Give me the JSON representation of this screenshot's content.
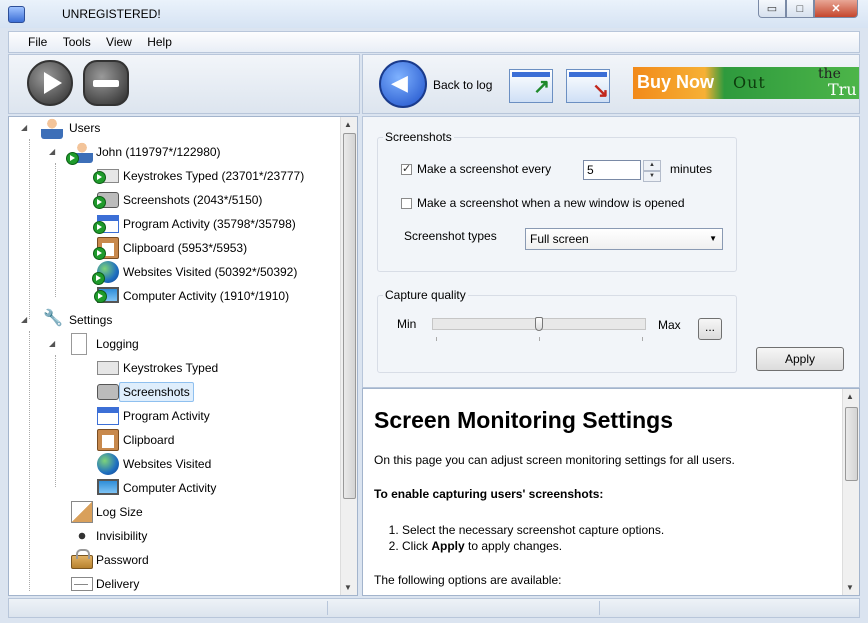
{
  "window": {
    "title": "UNREGISTERED!",
    "controls": {
      "minimize": "▭",
      "maximize": "□",
      "close": "✕"
    }
  },
  "menu": [
    "File",
    "Tools",
    "View",
    "Help"
  ],
  "toolbar": {
    "start_icon": "play-icon",
    "stop_icon": "stop-icon",
    "back_label": "Back to log",
    "buy_now": "Buy Now",
    "banner_text_1": "Out",
    "banner_text_2": "the",
    "banner_text_3": "Tru"
  },
  "tree": {
    "users_label": "Users",
    "user": "John (119797*/122980)",
    "user_items": [
      "Keystrokes Typed (23701*/23777)",
      "Screenshots (2043*/5150)",
      "Program Activity (35798*/35798)",
      "Clipboard (5953*/5953)",
      "Websites Visited (50392*/50392)",
      "Computer Activity (1910*/1910)"
    ],
    "settings_label": "Settings",
    "logging_label": "Logging",
    "logging_items": [
      "Keystrokes Typed",
      "Screenshots",
      "Program Activity",
      "Clipboard",
      "Websites Visited",
      "Computer Activity"
    ],
    "selected_item": "Screenshots",
    "other_settings": [
      "Log Size",
      "Invisibility",
      "Password",
      "Delivery"
    ]
  },
  "screenshots": {
    "group_label": "Screenshots",
    "every_label": "Make a screenshot every",
    "every_checked": true,
    "every_value": "5",
    "every_unit": "minutes",
    "new_window_label": "Make a screenshot when a new window is opened",
    "new_window_checked": false,
    "types_label": "Screenshot types",
    "types_value": "Full screen"
  },
  "quality": {
    "group_label": "Capture quality",
    "min_label": "Min",
    "max_label": "Max",
    "more_label": "...",
    "level_percent": 50
  },
  "apply_label": "Apply",
  "help": {
    "title": "Screen Monitoring Settings",
    "intro": "On this page you can adjust screen monitoring settings for all users.",
    "subheading": "To enable capturing users' screenshots:",
    "steps": [
      {
        "text": "Select the necessary screenshot capture options."
      },
      {
        "before": "Click ",
        "bold": "Apply",
        "after": " to apply changes."
      }
    ],
    "footer": "The following options are available:"
  }
}
